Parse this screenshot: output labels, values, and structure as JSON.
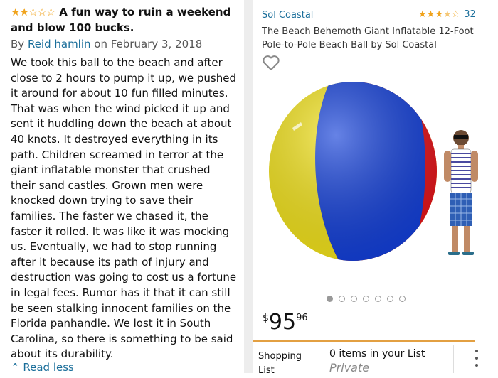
{
  "review": {
    "stars_filled": 2,
    "stars_total": 5,
    "title": "A fun way to ruin a weekend and blow 100 bucks.",
    "by_prefix": "By ",
    "author": "Reid hamlin",
    "date": " on February 3, 2018",
    "body": "We took this ball to the beach and after close to 2 hours to pump it up, we pushed it around for about 10 fun filled minutes. That was when the wind picked it up and sent it huddling down the beach at about 40 knots. It destroyed everything in its path. Children screamed in terror at the giant inflatable monster that crushed their sand castles. Grown men were knocked down trying to save their families. The faster we chased it, the faster it rolled. It was like it was mocking us. Eventually, we had to stop running after it because its path of injury and destruction was going to cost us a fortune in legal fees. Rumor has it that it can still be seen stalking innocent families on the Florida panhandle. We lost it in South Carolina, so there is something to be said about its durability.",
    "read_less": "Read less",
    "read_less_icon": "double-chevron-up-icon"
  },
  "product": {
    "brand": "Sol Coastal",
    "rating_stars": 3.5,
    "rating_count": "32",
    "title": "The Beach Behemoth Giant Inflatable 12-Foot Pole-to-Pole Beach Ball by Sol Coastal",
    "wishlist_icon": "heart-outline-icon",
    "carousel": {
      "total": 7,
      "active": 1
    },
    "price": {
      "symbol": "$",
      "whole": "95",
      "cents": "96"
    },
    "shopping_list_label": "Shopping List",
    "list_status": "0 items in your List",
    "list_privacy": "Private",
    "more_icon": "vertical-ellipsis-icon"
  },
  "colors": {
    "link": "#1a6e9a",
    "star": "#f0a31c",
    "tab_accent": "#e3a042",
    "ball_yellow": "#f2e21b",
    "ball_blue": "#1440d8",
    "ball_red": "#e3161c"
  }
}
